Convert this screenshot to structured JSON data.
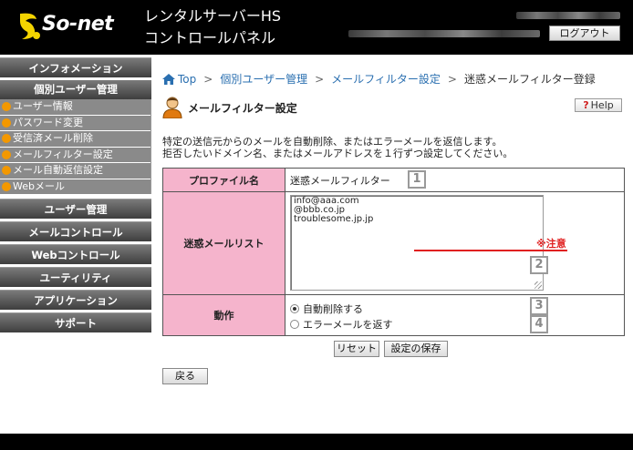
{
  "header": {
    "logo": "So-net",
    "title_line1": "レンタルサーバーHS",
    "title_line2": "コントロールパネル",
    "logout_label": "ログアウト"
  },
  "sidebar": {
    "item_info": "インフォメーション",
    "personal_head": "個別ユーザー管理",
    "personal_items": [
      "ユーザー情報",
      "パスワード変更",
      "受信済メール削除",
      "メールフィルター設定",
      "メール自動返信設定",
      "Webメール"
    ],
    "item_user": "ユーザー管理",
    "item_mail": "メールコントロール",
    "item_web": "Webコントロール",
    "item_util": "ユーティリティ",
    "item_app": "アプリケーション",
    "item_support": "サポート"
  },
  "breadcrumb": {
    "top": "Top",
    "personal": "個別ユーザー管理",
    "filter": "メールフィルター設定",
    "current": "迷惑メールフィルター登録"
  },
  "page": {
    "title": "メールフィルター設定",
    "help_label": "Help",
    "desc_line1": "特定の送信元からのメールを自動削除、またはエラーメールを返信します。",
    "desc_line2": "拒否したいドメイン名、またはメールアドレスを１行ずつ設定してください。"
  },
  "form": {
    "profile_label": "プロファイル名",
    "profile_value": "迷惑メールフィルター",
    "list_label": "迷惑メールリスト",
    "list_entries": [
      "info@aaa.com",
      "@bbb.co.jp",
      "troublesome.jp.jp"
    ],
    "caution": "※注意",
    "action_label": "動作",
    "opt_delete": "自動削除する",
    "opt_error": "エラーメールを返す",
    "selected": "自動削除する",
    "badges": [
      "1",
      "2",
      "3",
      "4"
    ]
  },
  "buttons": {
    "reset": "リセット",
    "save": "設定の保存",
    "back": "戻る"
  },
  "colors": {
    "label_pink": "#f5b4cc",
    "accent_red": "#e02020",
    "nav_gray": "#3e3e3e",
    "dot_orange": "#f39800",
    "link_blue": "#2a6fb0"
  }
}
